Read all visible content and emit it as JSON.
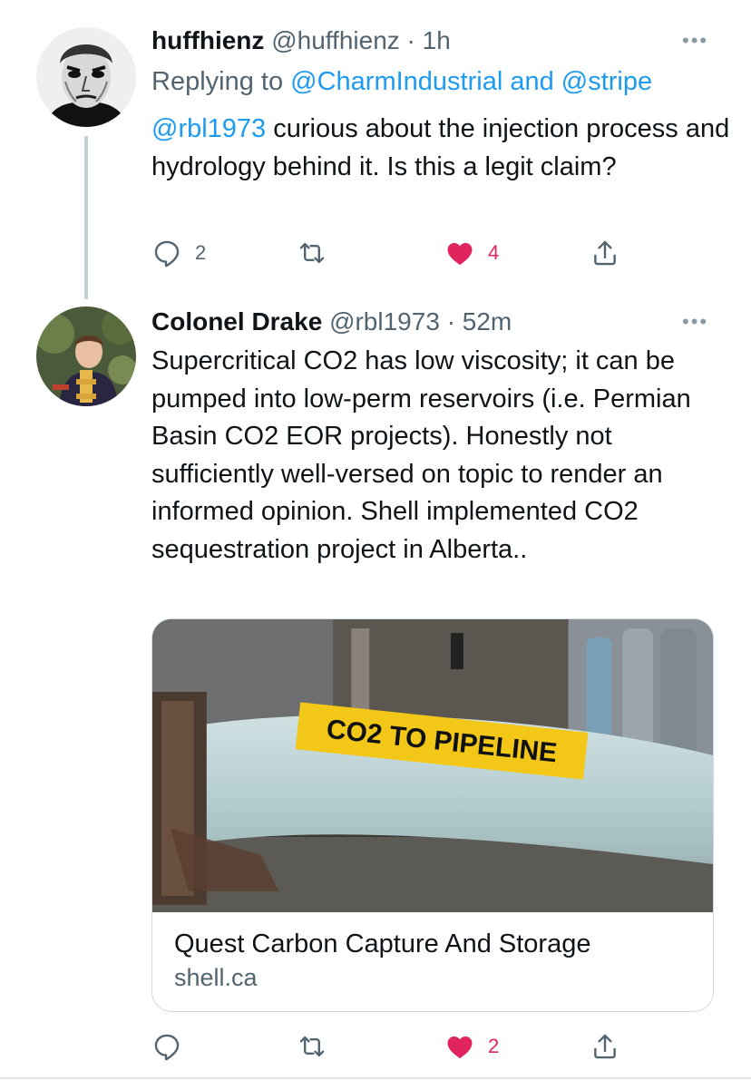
{
  "tweets": [
    {
      "name": "huffhienz",
      "handle": "@huffhienz",
      "time": "· 1h",
      "more": "•••",
      "reply_prefix": "Replying to ",
      "reply_targets": "@CharmIndustrial and @stripe",
      "mention": "@rbl1973",
      "text": " curious about the injection process and hydrology behind it.  Is this a legit claim?",
      "replies": "2",
      "likes": "4"
    },
    {
      "name": "Colonel Drake",
      "handle": "@rbl1973",
      "time": "· 52m",
      "more": "•••",
      "text": "Supercritical CO2 has low viscosity; it can be pumped into low-perm reservoirs (i.e. Permian Basin CO2 EOR projects). Honestly not sufficiently well-versed on topic to render an informed opinion.  Shell implemented CO2 sequestration project in Alberta..",
      "card": {
        "title": "Quest Carbon Capture And Storage",
        "domain": "shell.ca",
        "image_label": "CO2 TO PIPELINE"
      },
      "likes": "2"
    }
  ],
  "colors": {
    "link": "#1d9bf0",
    "like": "#e0245e",
    "muted": "#536471"
  },
  "icons": [
    "reply-icon",
    "retweet-icon",
    "heart-icon",
    "share-icon",
    "more-icon"
  ]
}
